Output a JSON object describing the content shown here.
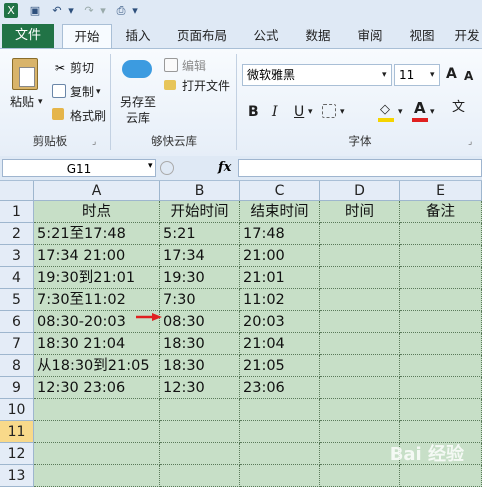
{
  "quick_access": {
    "icons": [
      "excel-logo-icon",
      "save-icon",
      "undo-icon",
      "redo-icon",
      "print-preview-icon",
      "customize-icon"
    ]
  },
  "tabs": {
    "file": "文件",
    "items": [
      "开始",
      "插入",
      "页面布局",
      "公式",
      "数据",
      "审阅",
      "视图",
      "开发"
    ],
    "active": "开始"
  },
  "ribbon": {
    "clipboard": {
      "paste": "粘贴",
      "cut": "剪切",
      "copy": "复制",
      "format_painter": "格式刷",
      "group": "剪贴板"
    },
    "cloud": {
      "save_cloud": "另存至云库",
      "edit": "编辑",
      "open_file": "打开文件",
      "group": "够快云库"
    },
    "font": {
      "name": "微软雅黑",
      "size": "11",
      "group": "字体",
      "font_color": "#e02020",
      "fill_color": "#f5d400"
    }
  },
  "formula_bar": {
    "name_box": "G11",
    "fx": "fx",
    "value": ""
  },
  "columns": [
    "A",
    "B",
    "C",
    "D",
    "E"
  ],
  "rows": [
    {
      "n": "1",
      "cells": [
        "时点",
        "开始时间",
        "结束时间",
        "时间",
        "备注"
      ]
    },
    {
      "n": "2",
      "cells": [
        "5:21至17:48",
        "5:21",
        "17:48",
        "",
        ""
      ]
    },
    {
      "n": "3",
      "cells": [
        "17:34 21:00",
        "17:34",
        "21:00",
        "",
        ""
      ]
    },
    {
      "n": "4",
      "cells": [
        "19:30到21:01",
        "19:30",
        "21:01",
        "",
        ""
      ]
    },
    {
      "n": "5",
      "cells": [
        "7:30至11:02",
        "7:30",
        "11:02",
        "",
        ""
      ]
    },
    {
      "n": "6",
      "cells": [
        "08:30-20:03",
        "08:30",
        "20:03",
        "",
        ""
      ]
    },
    {
      "n": "7",
      "cells": [
        "18:30 21:04",
        "18:30",
        "21:04",
        "",
        ""
      ]
    },
    {
      "n": "8",
      "cells": [
        "从18:30到21:05",
        "18:30",
        "21:05",
        "",
        ""
      ]
    },
    {
      "n": "9",
      "cells": [
        "12:30 23:06",
        "12:30",
        "23:06",
        "",
        ""
      ]
    },
    {
      "n": "10",
      "cells": [
        "",
        "",
        "",
        "",
        ""
      ]
    },
    {
      "n": "11",
      "cells": [
        "",
        "",
        "",
        "",
        ""
      ]
    },
    {
      "n": "12",
      "cells": [
        "",
        "",
        "",
        "",
        ""
      ]
    },
    {
      "n": "13",
      "cells": [
        "",
        "",
        "",
        "",
        ""
      ]
    }
  ],
  "selected_row": "11",
  "watermark": "Bai 经验"
}
